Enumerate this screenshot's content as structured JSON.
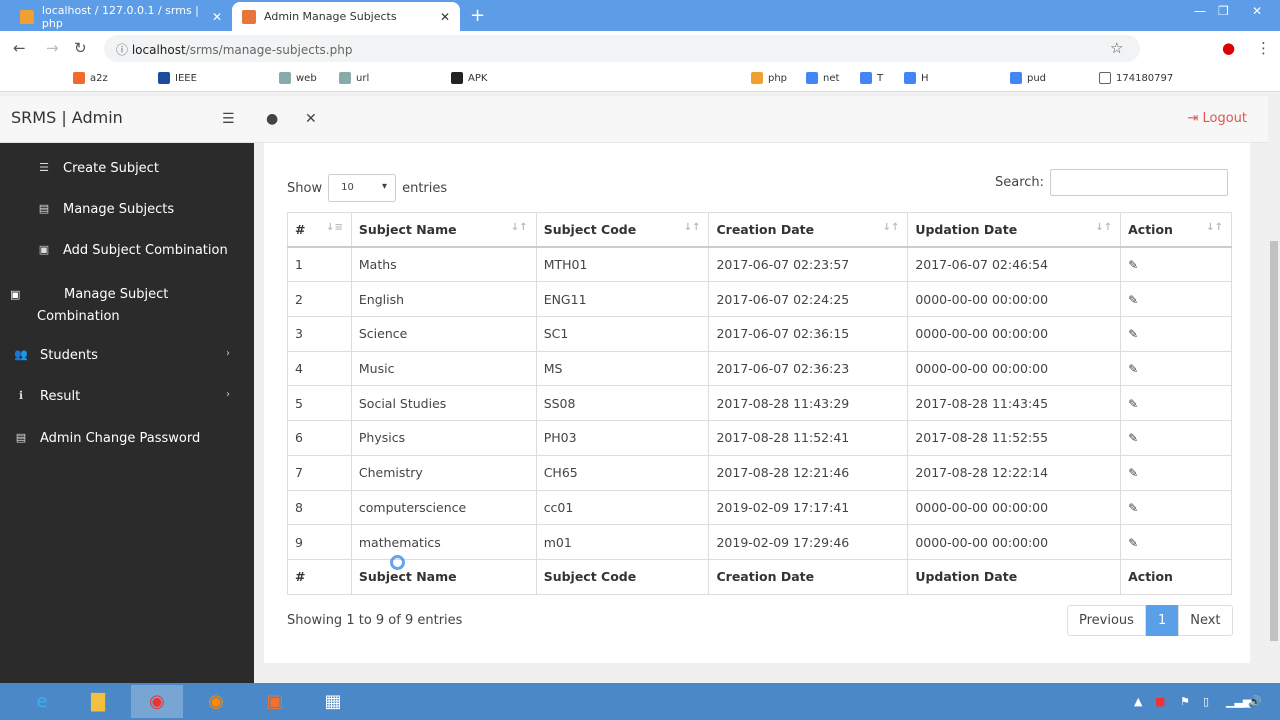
{
  "browser": {
    "tabs": [
      {
        "title": "localhost / 127.0.0.1 / srms | php"
      },
      {
        "title": "Admin Manage Subjects"
      }
    ],
    "url_host": "localhost",
    "url_path": "/srms/manage-subjects.php",
    "bookmarks": [
      "a2z",
      "IEEE",
      "web",
      "url",
      "APK",
      "php",
      "net",
      "T",
      "H",
      "pud",
      "174180797"
    ]
  },
  "header": {
    "brand": "SRMS | Admin",
    "logout": "Logout"
  },
  "sidebar": {
    "items": [
      {
        "label": "Create Subject",
        "icon": "bars-icon"
      },
      {
        "label": "Manage Subjects",
        "icon": "server-icon"
      },
      {
        "label": "Add Subject Combination",
        "icon": "newspaper-icon"
      },
      {
        "label": "Manage Subject Combination",
        "icon": "newspaper-icon"
      },
      {
        "label": "Students",
        "icon": "users-icon"
      },
      {
        "label": "Result",
        "icon": "info-icon"
      },
      {
        "label": "Admin Change Password",
        "icon": "list-icon"
      }
    ]
  },
  "controls": {
    "show": "Show",
    "entries_value": "10",
    "entries": "entries",
    "search_label": "Search:",
    "search_value": ""
  },
  "table": {
    "columns": [
      "#",
      "Subject Name",
      "Subject Code",
      "Creation Date",
      "Updation Date",
      "Action"
    ],
    "rows": [
      [
        "1",
        "Maths",
        "MTH01",
        "2017-06-07 02:23:57",
        "2017-06-07 02:46:54"
      ],
      [
        "2",
        "English",
        "ENG11",
        "2017-06-07 02:24:25",
        "0000-00-00 00:00:00"
      ],
      [
        "3",
        "Science",
        "SC1",
        "2017-06-07 02:36:15",
        "0000-00-00 00:00:00"
      ],
      [
        "4",
        "Music",
        "MS",
        "2017-06-07 02:36:23",
        "0000-00-00 00:00:00"
      ],
      [
        "5",
        "Social Studies",
        "SS08",
        "2017-08-28 11:43:29",
        "2017-08-28 11:43:45"
      ],
      [
        "6",
        "Physics",
        "PH03",
        "2017-08-28 11:52:41",
        "2017-08-28 11:52:55"
      ],
      [
        "7",
        "Chemistry",
        "CH65",
        "2017-08-28 12:21:46",
        "2017-08-28 12:22:14"
      ],
      [
        "8",
        "computerscience",
        "cc01",
        "2019-02-09 17:17:41",
        "0000-00-00 00:00:00"
      ],
      [
        "9",
        "mathematics",
        "m01",
        "2019-02-09 17:29:46",
        "0000-00-00 00:00:00"
      ]
    ]
  },
  "footer": {
    "info": "Showing 1 to 9 of 9 entries",
    "previous": "Previous",
    "page": "1",
    "next": "Next"
  },
  "colors": {
    "sidebar": "#2b2b2b",
    "accent": "#5aa0e8",
    "logout": "#e2574c",
    "chrome": "#5d9de8"
  }
}
